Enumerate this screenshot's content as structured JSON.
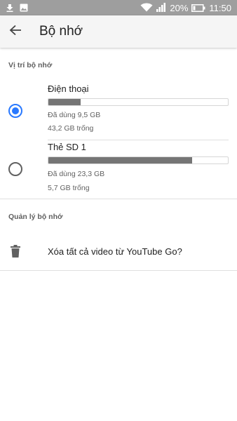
{
  "status_bar": {
    "icons": [
      "download-icon",
      "image-icon",
      "wifi-icon",
      "signal-icon",
      "battery-icon"
    ],
    "battery": "20%",
    "time": "11:50"
  },
  "app_bar": {
    "back_icon": "arrow-back-icon",
    "title": "Bộ nhớ"
  },
  "storage_location": {
    "header": "Vị trí bộ nhớ",
    "options": [
      {
        "name": "Điện thoại",
        "used": "Đã dùng 9,5 GB",
        "free": "43,2 GB trống",
        "used_fraction": 0.18,
        "selected": true
      },
      {
        "name": "Thẻ SD 1",
        "used": "Đã dùng 23,3 GB",
        "free": "5,7 GB trống",
        "used_fraction": 0.8,
        "selected": false
      }
    ]
  },
  "storage_management": {
    "header": "Quản lý bộ nhớ",
    "action_icon": "trash-icon",
    "action_label": "Xóa tất cả video từ YouTube Go?"
  },
  "colors": {
    "status_bar": "#9e9e9e",
    "accent": "#2979ff",
    "bar_fill": "#757575"
  }
}
